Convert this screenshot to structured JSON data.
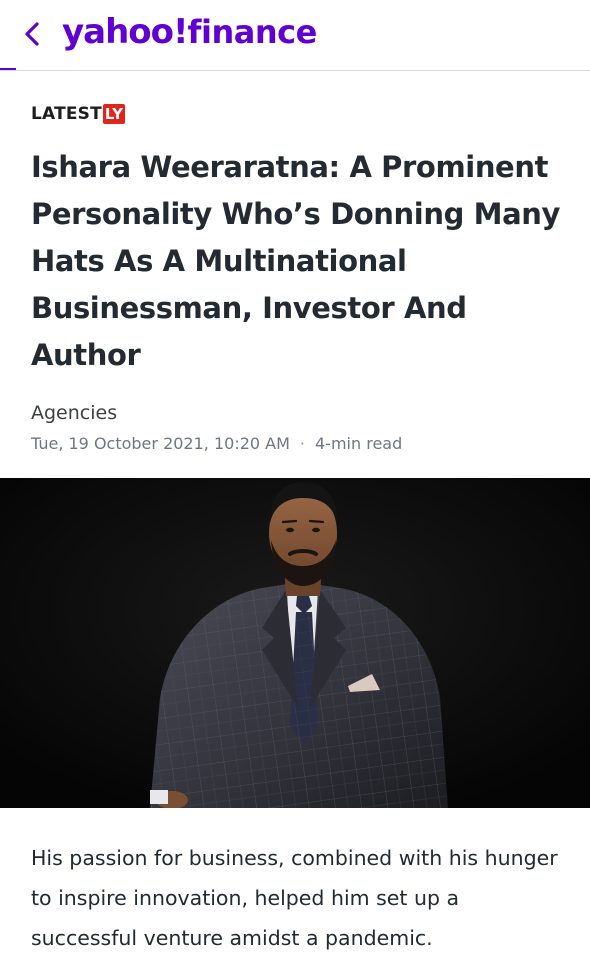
{
  "colors": {
    "brand_purple": "#6001d2",
    "source_badge_red": "#e1251b",
    "headline": "#232a31",
    "meta_gray": "#6e7780"
  },
  "header": {
    "back_icon": "chevron-left-icon",
    "logo_yahoo": "yahoo!",
    "logo_finance": "finance"
  },
  "article": {
    "source_label": "LATEST",
    "source_badge": "LY",
    "headline": "Ishara Weeraratna: A Prominent Personality Who’s Donning Many Hats As A Multinational Businessman, Investor And Author",
    "author": "Agencies",
    "published": "Tue, 19 October 2021, 10:20 AM",
    "separator": "·",
    "read_time": "4-min read",
    "hero_image": "portrait-photo",
    "body": "His passion for business, combined with his hunger to inspire innovation, helped him set up a successful venture amidst a pandemic."
  }
}
